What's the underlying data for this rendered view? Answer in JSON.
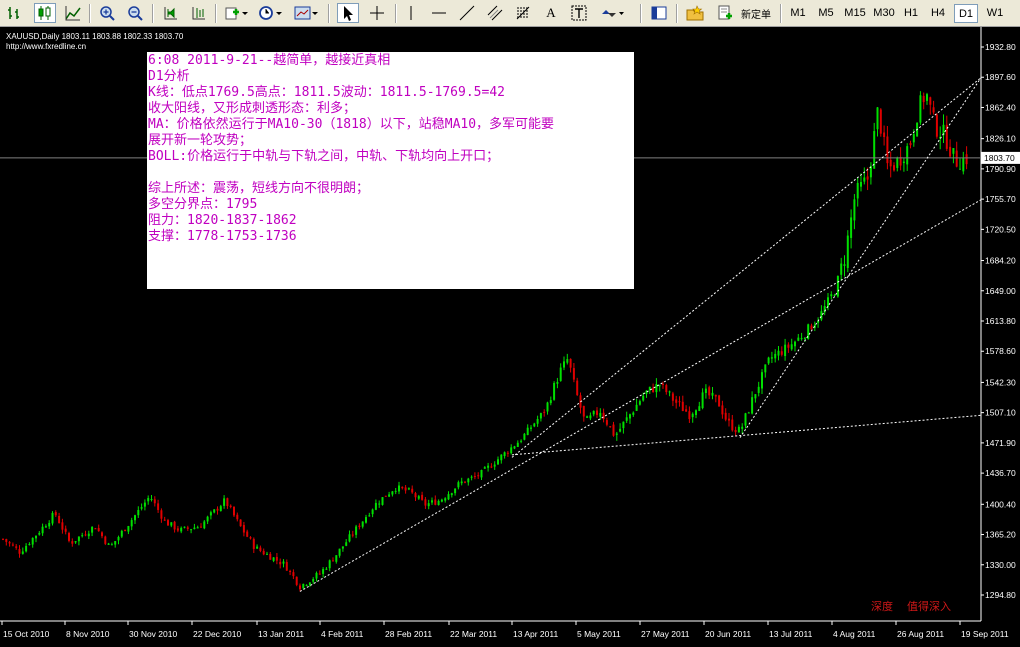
{
  "toolbar": {
    "new_order_label": "新定单",
    "timeframes": [
      "M1",
      "M5",
      "M15",
      "M30",
      "H1",
      "H4",
      "D1",
      "W1"
    ],
    "active_timeframe": "D1",
    "tools": [
      "bar-chart-icon",
      "candlestick-icon",
      "line-chart-icon",
      "zoom-in-icon",
      "zoom-out-icon",
      "auto-scroll-icon",
      "chart-shift-icon",
      "indicators-icon",
      "periods-icon",
      "templates-icon",
      "cursor-icon",
      "crosshair-icon",
      "vertical-line-icon",
      "horizontal-line-icon",
      "trendline-icon",
      "equidistant-channel-icon",
      "fibonacci-icon",
      "text-icon",
      "text-label-icon",
      "arrows-icon",
      "navigator-icon",
      "favorites-icon",
      "new-order-icon"
    ]
  },
  "chart": {
    "symbol_line": "XAUUSD,Daily  1803.11 1803.88 1802.33 1803.70",
    "website": "http://www.fxredline.cn",
    "current_price": "1803.70",
    "price_ticks": [
      "1932.80",
      "1897.60",
      "1862.40",
      "1826.10",
      "1790.90",
      "1755.70",
      "1720.50",
      "1684.20",
      "1649.00",
      "1613.80",
      "1578.60",
      "1542.30",
      "1507.10",
      "1471.90",
      "1436.70",
      "1400.40",
      "1365.20",
      "1330.00",
      "1294.80"
    ],
    "date_ticks": [
      "15 Oct 2010",
      "8 Nov 2010",
      "30 Nov 2010",
      "22 Dec 2010",
      "13 Jan 2011",
      "4 Feb 2011",
      "28 Feb 2011",
      "22 Mar 2011",
      "13 Apr 2011",
      "5 May 2011",
      "27 May 2011",
      "20 Jun 2011",
      "13 Jul 2011",
      "4 Aug 2011",
      "26 Aug 2011",
      "19 Sep 2011"
    ],
    "colors": {
      "background": "#000000",
      "bull": "#00e000",
      "bear": "#e00000",
      "grid": "#808080",
      "axis_text": "#ffffff"
    },
    "watermark": {
      "left": "深度",
      "right": "值得深入"
    }
  },
  "note": {
    "lines": [
      "6:08 2011-9-21--越简单，越接近真相",
      "D1分析",
      "K线：低点1769.5高点：1811.5波动：1811.5-1769.5=42",
      "收大阳线，又形成刺透形态：利多；",
      "MA：价格依然运行于MA10-30（1818）以下，站稳MA10，多军可能要",
      "展开新一轮攻势；",
      "BOLL:价格运行于中轨与下轨之间，中轨、下轨均向上开口；",
      "",
      "综上所述：震荡，短线方向不很明朗；",
      "多空分界点：1795",
      "阻力：1820-1837-1862",
      "支撑：1778-1753-1736"
    ]
  }
}
